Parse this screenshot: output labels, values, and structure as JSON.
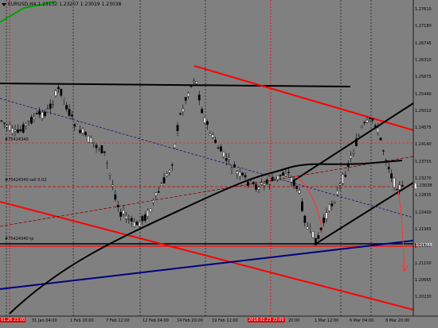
{
  "header": {
    "symbol": "EURUSD,H4",
    "ohlc": "1.23132 1.23207 1.23019 1.23038"
  },
  "order_labels": {
    "entry": "#75424340 sell 0.02",
    "tp": "#75424340 tp",
    "sl_partial": "#75424340"
  },
  "price_axis": {
    "ticks": [
      "1.27610",
      "1.27180",
      "1.26745",
      "1.26310",
      "1.25875",
      "1.25440",
      "1.25010",
      "1.24575",
      "1.24140",
      "1.23705",
      "1.23270",
      "1.22835",
      "1.22400",
      "1.21965",
      "1.21535",
      "1.21100",
      "1.20665",
      "1.20230"
    ],
    "current_price": "1.23038",
    "tp_price": "1.21788",
    "current_color": "#ffffff",
    "tp_color": "#e00000"
  },
  "time_axis": {
    "labels": [
      "31 Jan 04:00",
      "1 Feb 20:00",
      "7 Feb 12:00",
      "12 Feb 04:00",
      "14 Feb 20:00",
      "19 Feb 12:00",
      "1 Mar 12:00",
      "6 Mar 04:00",
      "8 Mar 20:00"
    ],
    "highlight_left": "01.26 23:00",
    "highlight_mid": "2018.02.23 23:00",
    "mid_after": "20:00"
  },
  "colors": {
    "background": "#808080",
    "bull_candle": "#e8e8e8",
    "bear_candle": "#000000",
    "trend_black": "#000000",
    "trend_red": "#ff0000",
    "trend_blue": "#000080",
    "trend_green": "#00a000"
  }
}
